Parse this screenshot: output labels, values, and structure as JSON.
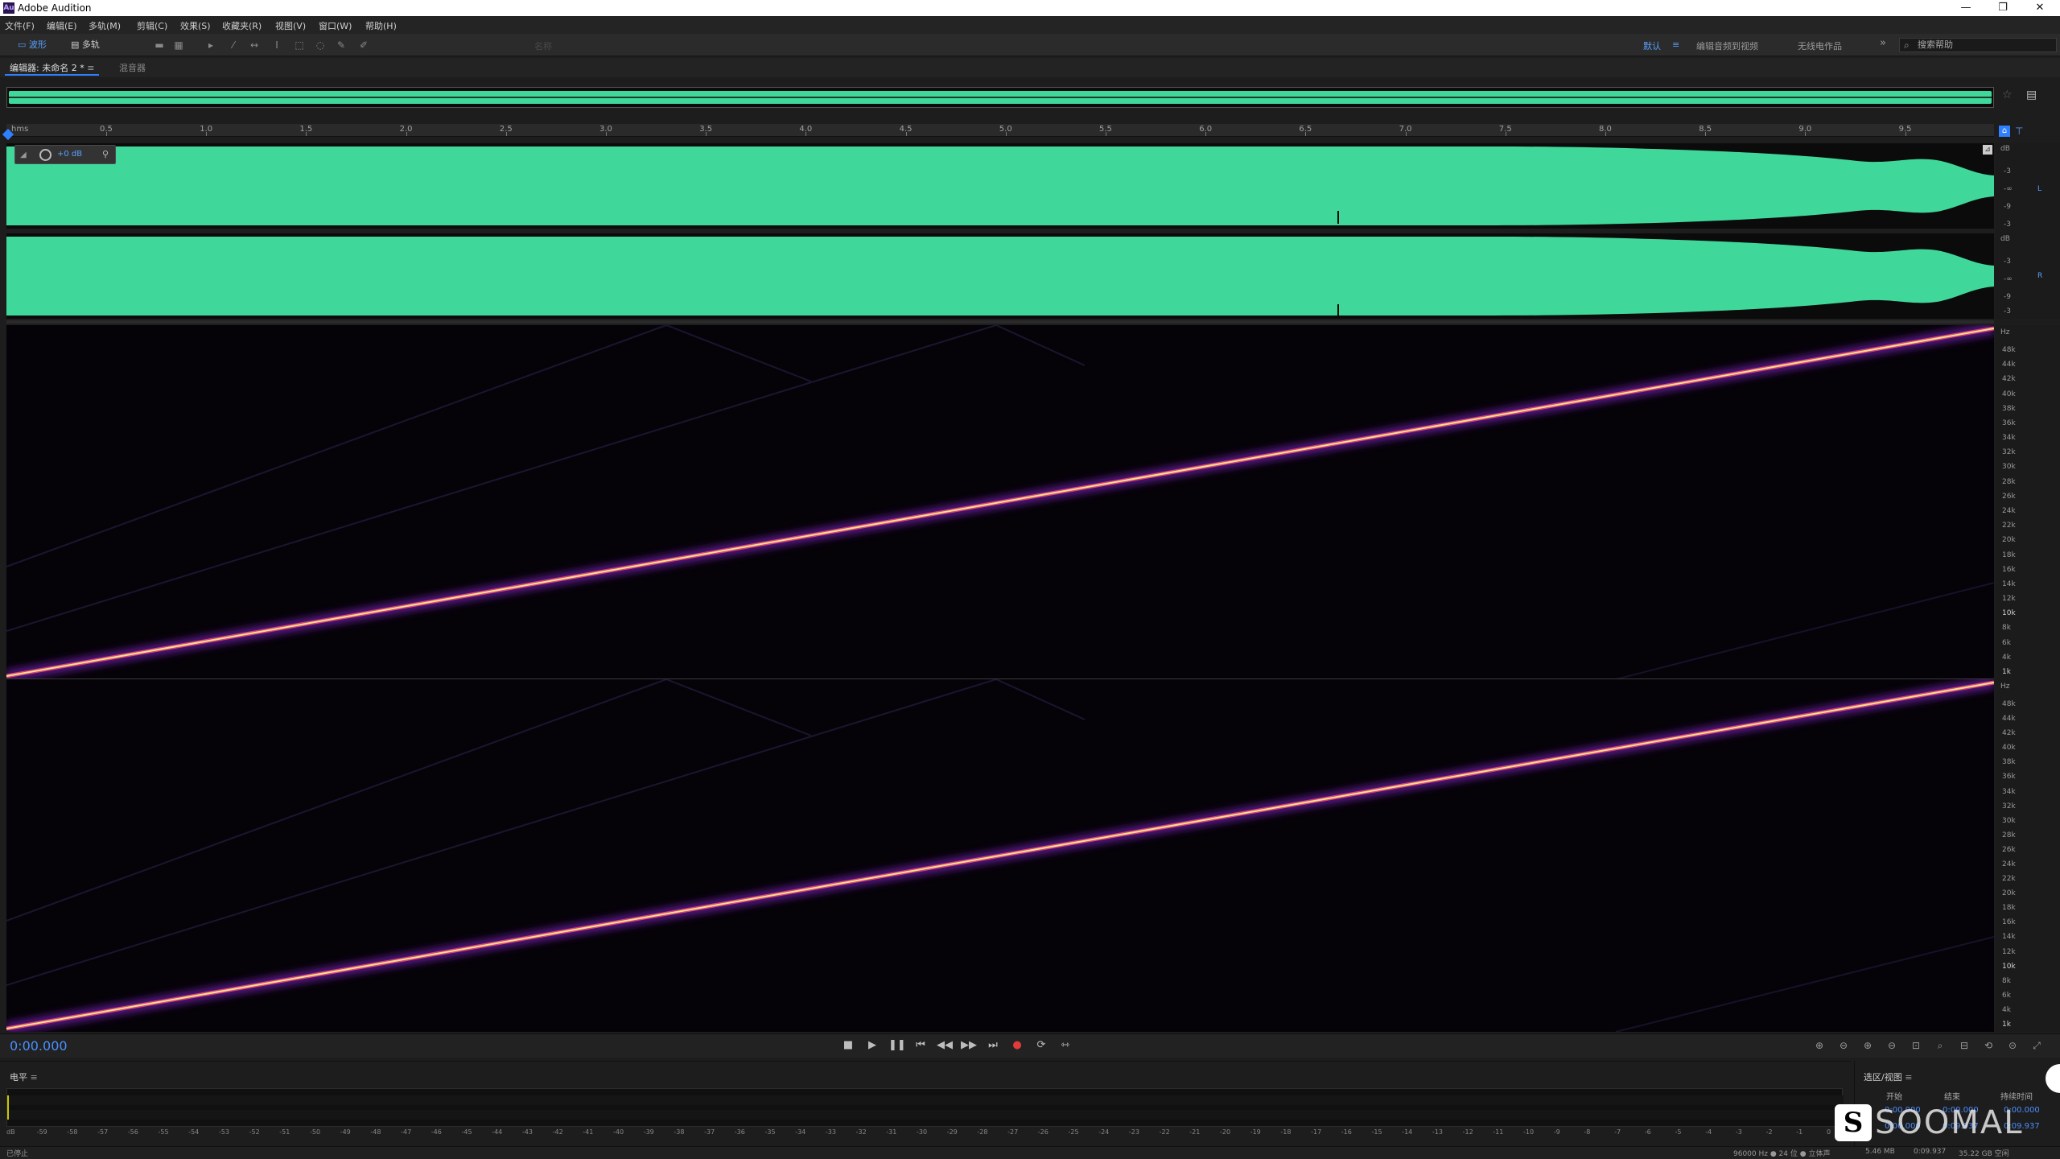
{
  "app": {
    "title": "Adobe Audition",
    "logo": "Au",
    "accent": "#2f7fff",
    "waveform_color": "#40d89a"
  },
  "menu": [
    "文件(F)",
    "编辑(E)",
    "多轨(M)",
    "剪辑(C)",
    "效果(S)",
    "收藏夹(R)",
    "视图(V)",
    "窗口(W)",
    "帮助(H)"
  ],
  "toolbar": {
    "mode_waveform": "波形",
    "mode_multitrack": "多轨",
    "center_hint": "名称",
    "workspaces": [
      "默认",
      "编辑音频到视频",
      "无线电作品"
    ],
    "more": "»",
    "search_placeholder": "搜索帮助"
  },
  "tabs": {
    "editor": "编辑器: 未命名 2 *",
    "mixer": "混音器"
  },
  "ruler": {
    "unit": "hms",
    "labels": [
      "0.5",
      "1.0",
      "1.5",
      "2.0",
      "2.5",
      "3.0",
      "3.5",
      "4.0",
      "4.5",
      "5.0",
      "5.5",
      "6.0",
      "6.5",
      "7.0",
      "7.5",
      "8.0",
      "8.5",
      "9.0",
      "9.5"
    ]
  },
  "hud": {
    "gain": "+0 dB"
  },
  "waveform_scale": {
    "unit": "dB",
    "labels": [
      "-3",
      "-9",
      "-∞",
      "-9",
      "-3"
    ],
    "left_ch": "L",
    "right_ch": "R"
  },
  "spectral_scale": {
    "unit": "Hz",
    "labels": [
      "48k",
      "44k",
      "42k",
      "40k",
      "38k",
      "36k",
      "34k",
      "32k",
      "30k",
      "28k",
      "26k",
      "24k",
      "22k",
      "20k",
      "18k",
      "16k",
      "14k",
      "12k",
      "10k",
      "8k",
      "6k",
      "4k",
      "1k"
    ]
  },
  "transport": {
    "timecode": "0:00.000"
  },
  "level_panel": {
    "title": "电平",
    "db_ticks": [
      "dB",
      "-59",
      "-58",
      "-57",
      "-56",
      "-55",
      "-54",
      "-53",
      "-52",
      "-51",
      "-50",
      "-49",
      "-48",
      "-47",
      "-46",
      "-45",
      "-44",
      "-43",
      "-42",
      "-41",
      "-40",
      "-39",
      "-38",
      "-37",
      "-36",
      "-35",
      "-34",
      "-33",
      "-32",
      "-31",
      "-30",
      "-29",
      "-28",
      "-27",
      "-26",
      "-25",
      "-24",
      "-23",
      "-22",
      "-21",
      "-20",
      "-19",
      "-18",
      "-17",
      "-16",
      "-15",
      "-14",
      "-13",
      "-12",
      "-11",
      "-10",
      "-9",
      "-8",
      "-7",
      "-6",
      "-5",
      "-4",
      "-3",
      "-2",
      "-1",
      "0"
    ]
  },
  "selection_panel": {
    "title": "选区/视图",
    "headers": [
      "开始",
      "结束",
      "持续时间"
    ],
    "rows": [
      {
        "label": "选",
        "start": "0:00.000",
        "end": "0:00.000",
        "duration": "0:00.000"
      },
      {
        "label": "视",
        "start": "0:00.000",
        "end": "0:09.937",
        "duration": "0:09.937"
      }
    ]
  },
  "status": {
    "state": "已停止",
    "format": "96000 Hz ● 24 位 ● 立体声",
    "size": "5.46 MB",
    "duration": "0:09.937",
    "free": "35.22 GB 空闲"
  },
  "watermark": {
    "logo": "S",
    "text": "SOOMAL"
  }
}
